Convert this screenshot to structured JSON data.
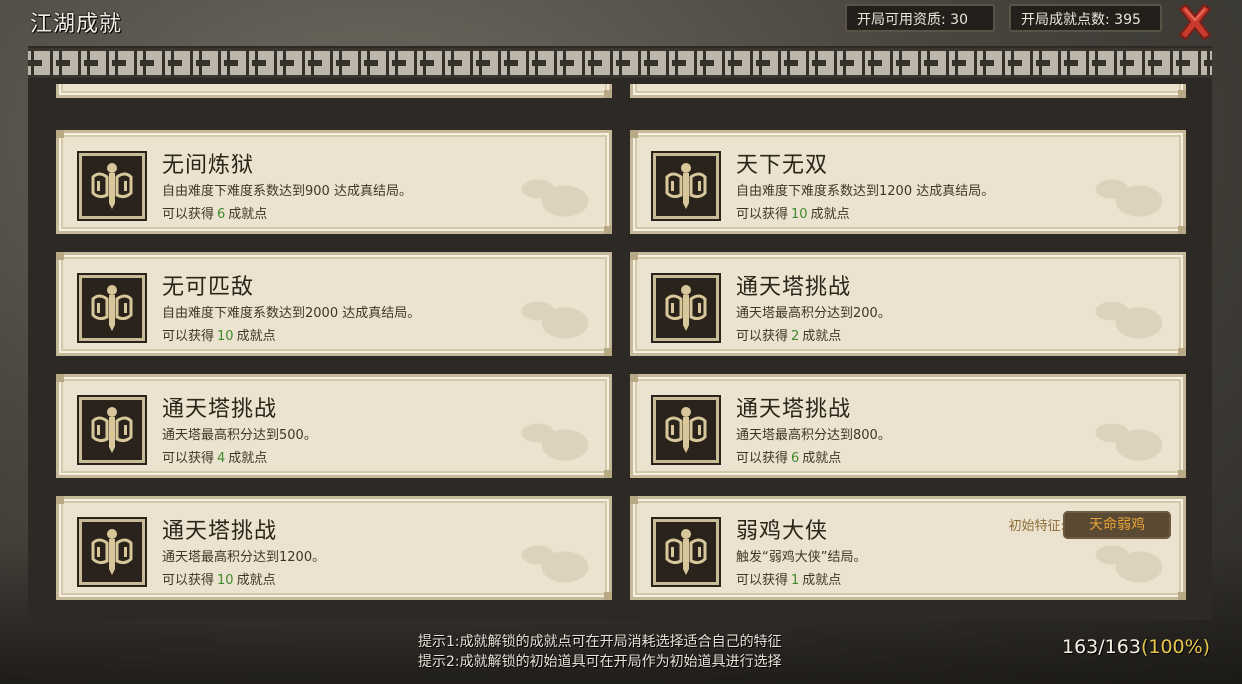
{
  "header": {
    "title": "江湖成就",
    "stat_talent_label": "开局可用资质:",
    "stat_talent_value": "30",
    "stat_points_label": "开局成就点数:",
    "stat_points_value": "395",
    "close_icon": "close-x-icon",
    "close_color": "#c83a2e"
  },
  "cards": [
    {
      "title": "无间炼狱",
      "desc": "自由难度下难度系数达到900 达成真结局。",
      "reward_prefix": "可以获得",
      "reward_value": "6",
      "reward_suffix": "成就点",
      "icon": "sword-emblem-icon"
    },
    {
      "title": "天下无双",
      "desc": "自由难度下难度系数达到1200 达成真结局。",
      "reward_prefix": "可以获得",
      "reward_value": "10",
      "reward_suffix": "成就点",
      "icon": "sword-emblem-icon"
    },
    {
      "title": "无可匹敌",
      "desc": "自由难度下难度系数达到2000 达成真结局。",
      "reward_prefix": "可以获得",
      "reward_value": "10",
      "reward_suffix": "成就点",
      "icon": "sword-emblem-icon"
    },
    {
      "title": "通天塔挑战",
      "desc": "通天塔最高积分达到200。",
      "reward_prefix": "可以获得",
      "reward_value": "2",
      "reward_suffix": "成就点",
      "icon": "sword-emblem-icon"
    },
    {
      "title": "通天塔挑战",
      "desc": "通天塔最高积分达到500。",
      "reward_prefix": "可以获得",
      "reward_value": "4",
      "reward_suffix": "成就点",
      "icon": "sword-emblem-icon"
    },
    {
      "title": "通天塔挑战",
      "desc": "通天塔最高积分达到800。",
      "reward_prefix": "可以获得",
      "reward_value": "6",
      "reward_suffix": "成就点",
      "icon": "sword-emblem-icon"
    },
    {
      "title": "通天塔挑战",
      "desc": "通天塔最高积分达到1200。",
      "reward_prefix": "可以获得",
      "reward_value": "10",
      "reward_suffix": "成就点",
      "icon": "sword-emblem-icon"
    },
    {
      "title": "弱鸡大侠",
      "desc": "触发“弱鸡大侠”结局。",
      "reward_prefix": "可以获得",
      "reward_value": "1",
      "reward_suffix": "成就点",
      "icon": "sword-emblem-icon",
      "trait_label": "初始特征:",
      "trait_value": "天命弱鸡"
    }
  ],
  "tips": {
    "line1": "提示1:成就解锁的成就点可在开局消耗选择适合自己的特征",
    "line2": "提示2:成就解锁的初始道具可在开局作为初始道具进行选择"
  },
  "progress": {
    "count": "163/163",
    "percent": "(100%)"
  },
  "colors": {
    "reward_number": "#3f8a2e",
    "trait_badge_text": "#e9a437",
    "card_bg": "#ebe3cf"
  }
}
